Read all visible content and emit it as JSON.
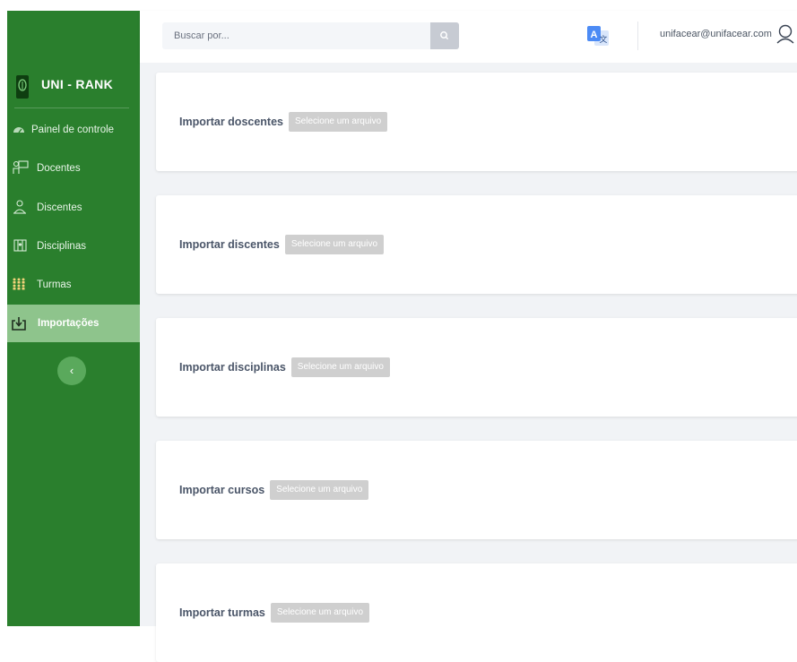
{
  "brand": {
    "name": "UNI - RANK"
  },
  "sidebar": {
    "items": [
      {
        "label": "Painel de controle",
        "icon": "dashboard-icon",
        "active": false
      },
      {
        "label": "Docentes",
        "icon": "teacher-icon",
        "active": false
      },
      {
        "label": "Discentes",
        "icon": "student-icon",
        "active": false
      },
      {
        "label": "Disciplinas",
        "icon": "books-icon",
        "active": false
      },
      {
        "label": "Turmas",
        "icon": "group-icon",
        "active": false
      },
      {
        "label": "Importações",
        "icon": "import-icon",
        "active": true
      }
    ],
    "collapse_icon": "chevron-left-icon"
  },
  "header": {
    "search_placeholder": "Buscar por...",
    "search_icon": "search-icon",
    "translate_icon": "translate-icon",
    "user_email": "unifacear@unifacear.com",
    "user_icon": "user-icon"
  },
  "imports": [
    {
      "label": "Importar doscentes",
      "button": "Selecione um arquivo"
    },
    {
      "label": "Importar discentes",
      "button": "Selecione um arquivo"
    },
    {
      "label": "Importar disciplinas",
      "button": "Selecione um arquivo"
    },
    {
      "label": "Importar cursos",
      "button": "Selecione um arquivo"
    },
    {
      "label": "Importar turmas",
      "button": "Selecione um arquivo"
    }
  ],
  "colors": {
    "sidebar": "#2a7f2d",
    "sidebar_active": "#8ec48c",
    "accent_blue": "#4c8bf5",
    "button_gray": "#cfcfcf"
  }
}
